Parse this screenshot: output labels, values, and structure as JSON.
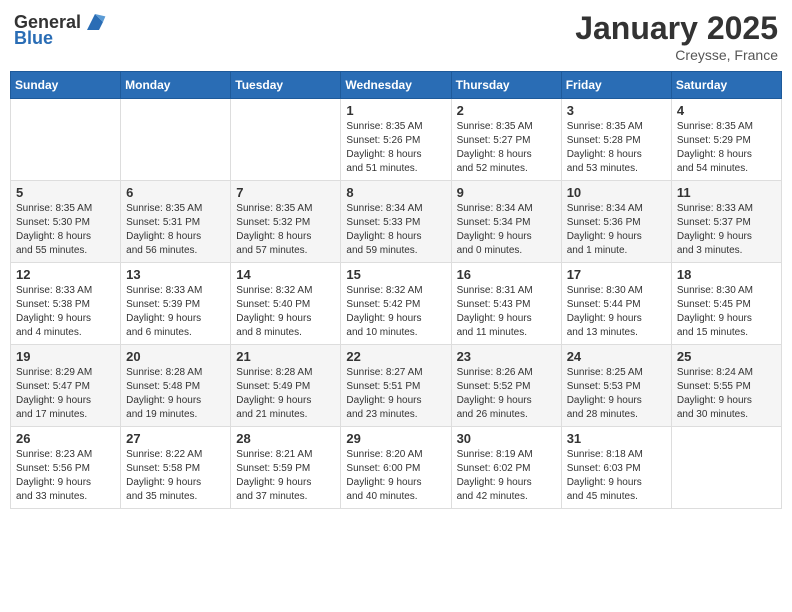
{
  "header": {
    "logo_general": "General",
    "logo_blue": "Blue",
    "month": "January 2025",
    "location": "Creysse, France"
  },
  "weekdays": [
    "Sunday",
    "Monday",
    "Tuesday",
    "Wednesday",
    "Thursday",
    "Friday",
    "Saturday"
  ],
  "weeks": [
    [
      {
        "day": "",
        "info": ""
      },
      {
        "day": "",
        "info": ""
      },
      {
        "day": "",
        "info": ""
      },
      {
        "day": "1",
        "info": "Sunrise: 8:35 AM\nSunset: 5:26 PM\nDaylight: 8 hours\nand 51 minutes."
      },
      {
        "day": "2",
        "info": "Sunrise: 8:35 AM\nSunset: 5:27 PM\nDaylight: 8 hours\nand 52 minutes."
      },
      {
        "day": "3",
        "info": "Sunrise: 8:35 AM\nSunset: 5:28 PM\nDaylight: 8 hours\nand 53 minutes."
      },
      {
        "day": "4",
        "info": "Sunrise: 8:35 AM\nSunset: 5:29 PM\nDaylight: 8 hours\nand 54 minutes."
      }
    ],
    [
      {
        "day": "5",
        "info": "Sunrise: 8:35 AM\nSunset: 5:30 PM\nDaylight: 8 hours\nand 55 minutes."
      },
      {
        "day": "6",
        "info": "Sunrise: 8:35 AM\nSunset: 5:31 PM\nDaylight: 8 hours\nand 56 minutes."
      },
      {
        "day": "7",
        "info": "Sunrise: 8:35 AM\nSunset: 5:32 PM\nDaylight: 8 hours\nand 57 minutes."
      },
      {
        "day": "8",
        "info": "Sunrise: 8:34 AM\nSunset: 5:33 PM\nDaylight: 8 hours\nand 59 minutes."
      },
      {
        "day": "9",
        "info": "Sunrise: 8:34 AM\nSunset: 5:34 PM\nDaylight: 9 hours\nand 0 minutes."
      },
      {
        "day": "10",
        "info": "Sunrise: 8:34 AM\nSunset: 5:36 PM\nDaylight: 9 hours\nand 1 minute."
      },
      {
        "day": "11",
        "info": "Sunrise: 8:33 AM\nSunset: 5:37 PM\nDaylight: 9 hours\nand 3 minutes."
      }
    ],
    [
      {
        "day": "12",
        "info": "Sunrise: 8:33 AM\nSunset: 5:38 PM\nDaylight: 9 hours\nand 4 minutes."
      },
      {
        "day": "13",
        "info": "Sunrise: 8:33 AM\nSunset: 5:39 PM\nDaylight: 9 hours\nand 6 minutes."
      },
      {
        "day": "14",
        "info": "Sunrise: 8:32 AM\nSunset: 5:40 PM\nDaylight: 9 hours\nand 8 minutes."
      },
      {
        "day": "15",
        "info": "Sunrise: 8:32 AM\nSunset: 5:42 PM\nDaylight: 9 hours\nand 10 minutes."
      },
      {
        "day": "16",
        "info": "Sunrise: 8:31 AM\nSunset: 5:43 PM\nDaylight: 9 hours\nand 11 minutes."
      },
      {
        "day": "17",
        "info": "Sunrise: 8:30 AM\nSunset: 5:44 PM\nDaylight: 9 hours\nand 13 minutes."
      },
      {
        "day": "18",
        "info": "Sunrise: 8:30 AM\nSunset: 5:45 PM\nDaylight: 9 hours\nand 15 minutes."
      }
    ],
    [
      {
        "day": "19",
        "info": "Sunrise: 8:29 AM\nSunset: 5:47 PM\nDaylight: 9 hours\nand 17 minutes."
      },
      {
        "day": "20",
        "info": "Sunrise: 8:28 AM\nSunset: 5:48 PM\nDaylight: 9 hours\nand 19 minutes."
      },
      {
        "day": "21",
        "info": "Sunrise: 8:28 AM\nSunset: 5:49 PM\nDaylight: 9 hours\nand 21 minutes."
      },
      {
        "day": "22",
        "info": "Sunrise: 8:27 AM\nSunset: 5:51 PM\nDaylight: 9 hours\nand 23 minutes."
      },
      {
        "day": "23",
        "info": "Sunrise: 8:26 AM\nSunset: 5:52 PM\nDaylight: 9 hours\nand 26 minutes."
      },
      {
        "day": "24",
        "info": "Sunrise: 8:25 AM\nSunset: 5:53 PM\nDaylight: 9 hours\nand 28 minutes."
      },
      {
        "day": "25",
        "info": "Sunrise: 8:24 AM\nSunset: 5:55 PM\nDaylight: 9 hours\nand 30 minutes."
      }
    ],
    [
      {
        "day": "26",
        "info": "Sunrise: 8:23 AM\nSunset: 5:56 PM\nDaylight: 9 hours\nand 33 minutes."
      },
      {
        "day": "27",
        "info": "Sunrise: 8:22 AM\nSunset: 5:58 PM\nDaylight: 9 hours\nand 35 minutes."
      },
      {
        "day": "28",
        "info": "Sunrise: 8:21 AM\nSunset: 5:59 PM\nDaylight: 9 hours\nand 37 minutes."
      },
      {
        "day": "29",
        "info": "Sunrise: 8:20 AM\nSunset: 6:00 PM\nDaylight: 9 hours\nand 40 minutes."
      },
      {
        "day": "30",
        "info": "Sunrise: 8:19 AM\nSunset: 6:02 PM\nDaylight: 9 hours\nand 42 minutes."
      },
      {
        "day": "31",
        "info": "Sunrise: 8:18 AM\nSunset: 6:03 PM\nDaylight: 9 hours\nand 45 minutes."
      },
      {
        "day": "",
        "info": ""
      }
    ]
  ]
}
